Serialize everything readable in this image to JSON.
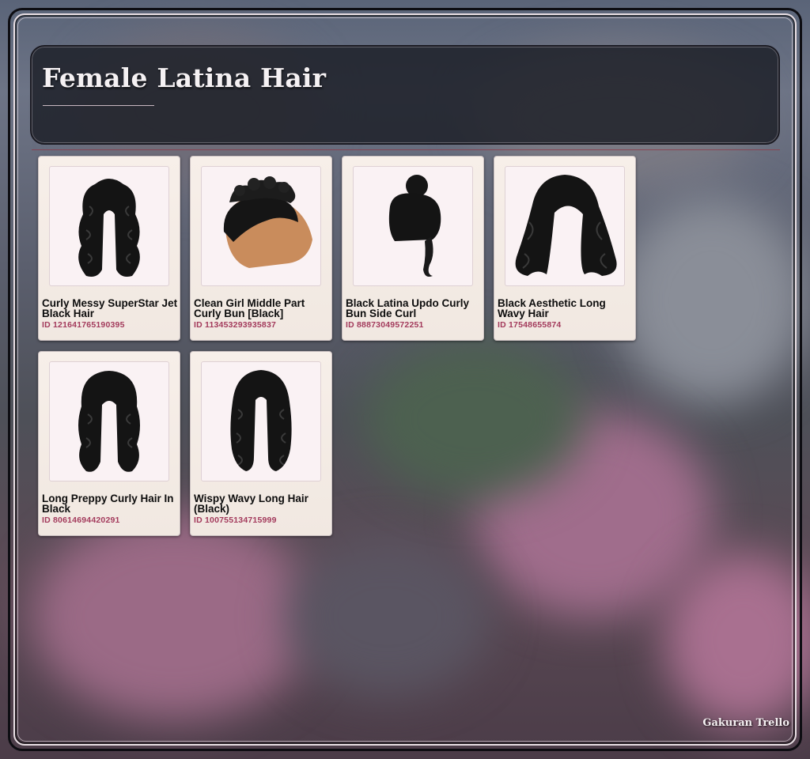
{
  "page": {
    "title": "Female Latina Hair",
    "footer": "Gakuran Trello"
  },
  "items": [
    {
      "name": "Curly Messy SuperStar Jet Black Hair",
      "id": "ID 121641765190395",
      "icon": "long-curly-hair-icon"
    },
    {
      "name": "Clean Girl Middle Part Curly Bun [Black]",
      "id": "ID 113453293935837",
      "icon": "curly-bun-hair-icon"
    },
    {
      "name": "Black Latina Updo Curly Bun Side Curl",
      "id": "ID 88873049572251",
      "icon": "updo-bun-hair-icon"
    },
    {
      "name": "Black Aesthetic Long Wavy Hair",
      "id": "ID 17548655874",
      "icon": "long-wavy-hair-icon"
    },
    {
      "name": "Long Preppy Curly Hair In Black",
      "id": "ID 80614694420291",
      "icon": "long-curly-hair-icon"
    },
    {
      "name": "Wispy Wavy Long Hair (Black)",
      "id": "ID 100755134715999",
      "icon": "wispy-wavy-hair-icon"
    }
  ]
}
